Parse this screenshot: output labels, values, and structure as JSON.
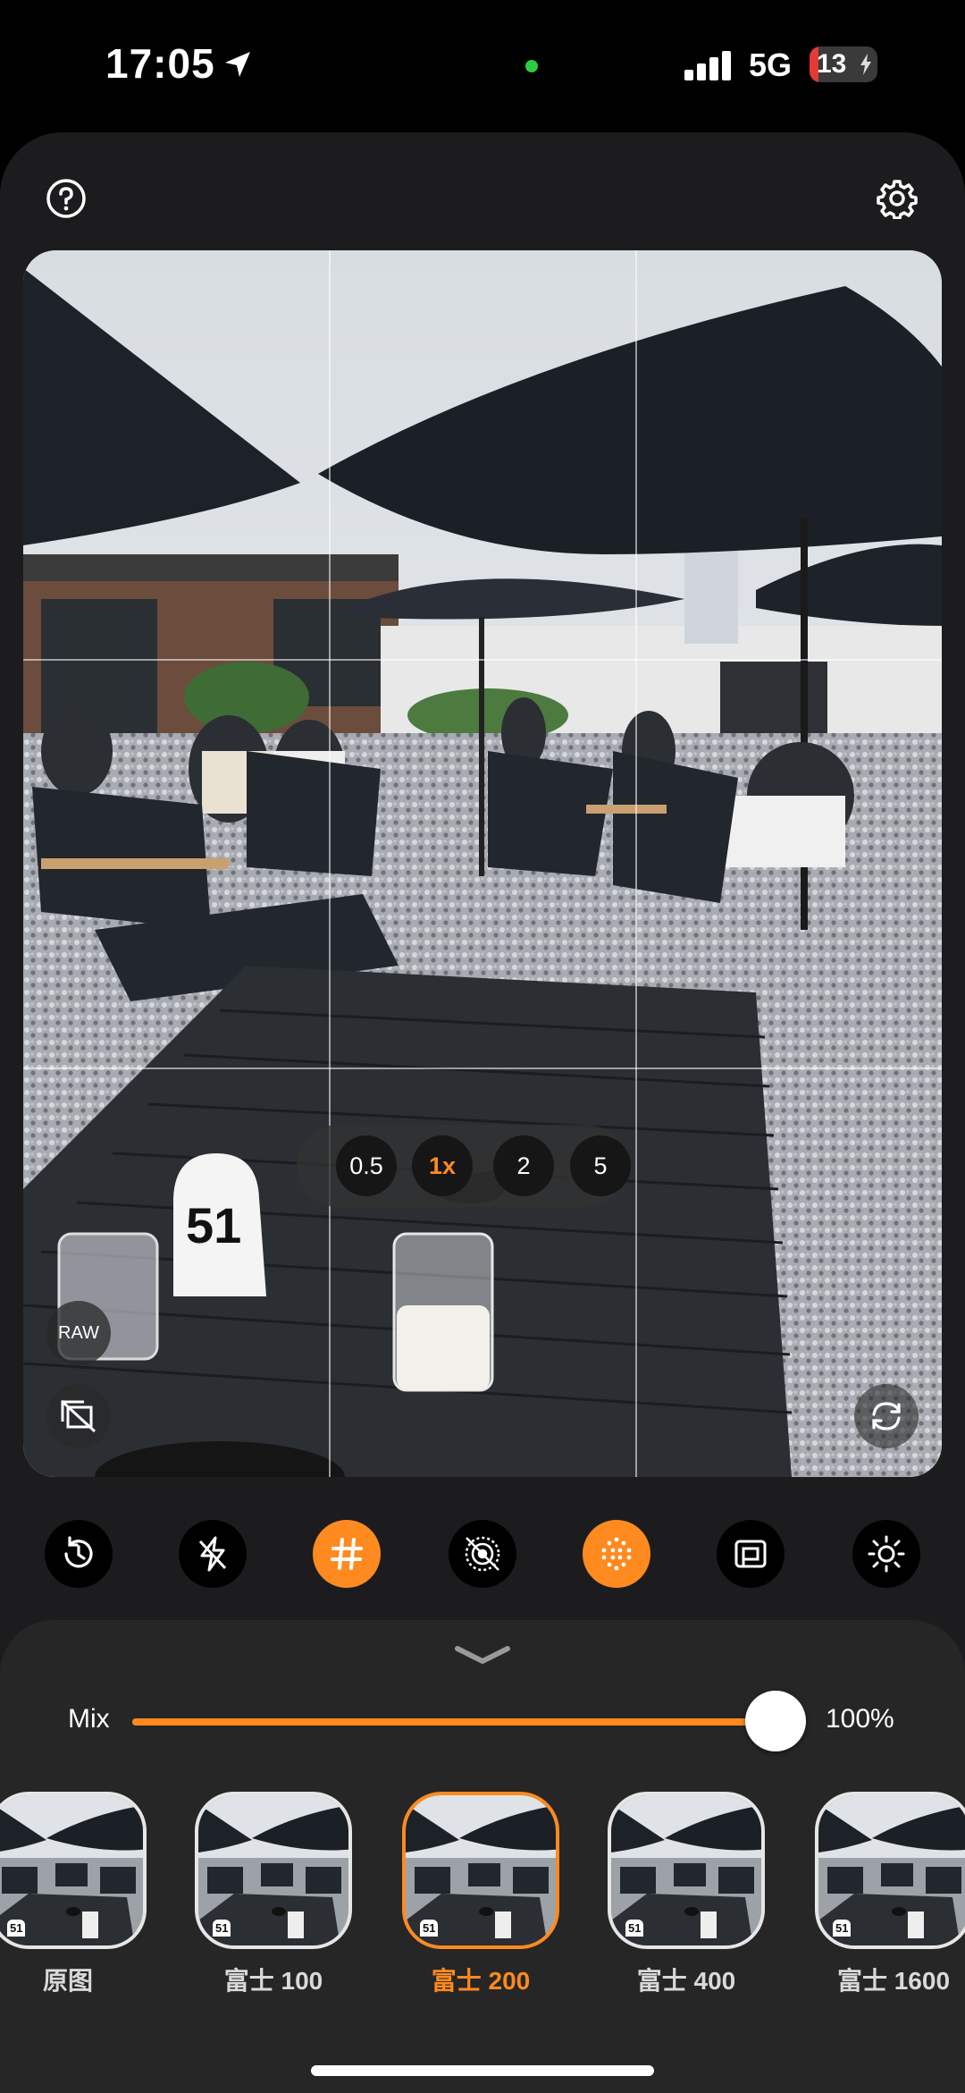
{
  "status_bar": {
    "time": "17:05",
    "network": "5G",
    "battery": "13",
    "battery_level_percent": 13,
    "signal_bars": 4
  },
  "top_bar": {
    "help_icon": "question-circle-icon",
    "settings_icon": "gear-icon"
  },
  "viewfinder": {
    "raw_label": "RAW",
    "grid": "3x3",
    "left_icon": "layers-off-icon",
    "right_icon": "flip-camera-icon",
    "table_number": "51"
  },
  "zoom": {
    "options": [
      "0.5",
      "1x",
      "2",
      "5"
    ],
    "selected": "1x"
  },
  "toolbar": {
    "tools": [
      {
        "icon": "history-icon",
        "active": false
      },
      {
        "icon": "flash-off-icon",
        "active": false
      },
      {
        "icon": "grid-hash-icon",
        "active": true
      },
      {
        "icon": "live-off-icon",
        "active": false
      },
      {
        "icon": "grain-dots-icon",
        "active": true
      },
      {
        "icon": "aspect-ratio-icon",
        "active": false
      },
      {
        "icon": "exposure-sun-icon",
        "active": false
      }
    ]
  },
  "mix": {
    "label": "Mix",
    "value": "100%",
    "level": 1.0
  },
  "filters": {
    "items": [
      {
        "label": "原图"
      },
      {
        "label": "富士 100"
      },
      {
        "label": "富士 200"
      },
      {
        "label": "富士 400"
      },
      {
        "label": "富士 1600"
      }
    ],
    "selected_index": 2
  },
  "colors": {
    "accent": "#ff8a1f",
    "background": "#1c1c1e",
    "panel": "#262626"
  }
}
